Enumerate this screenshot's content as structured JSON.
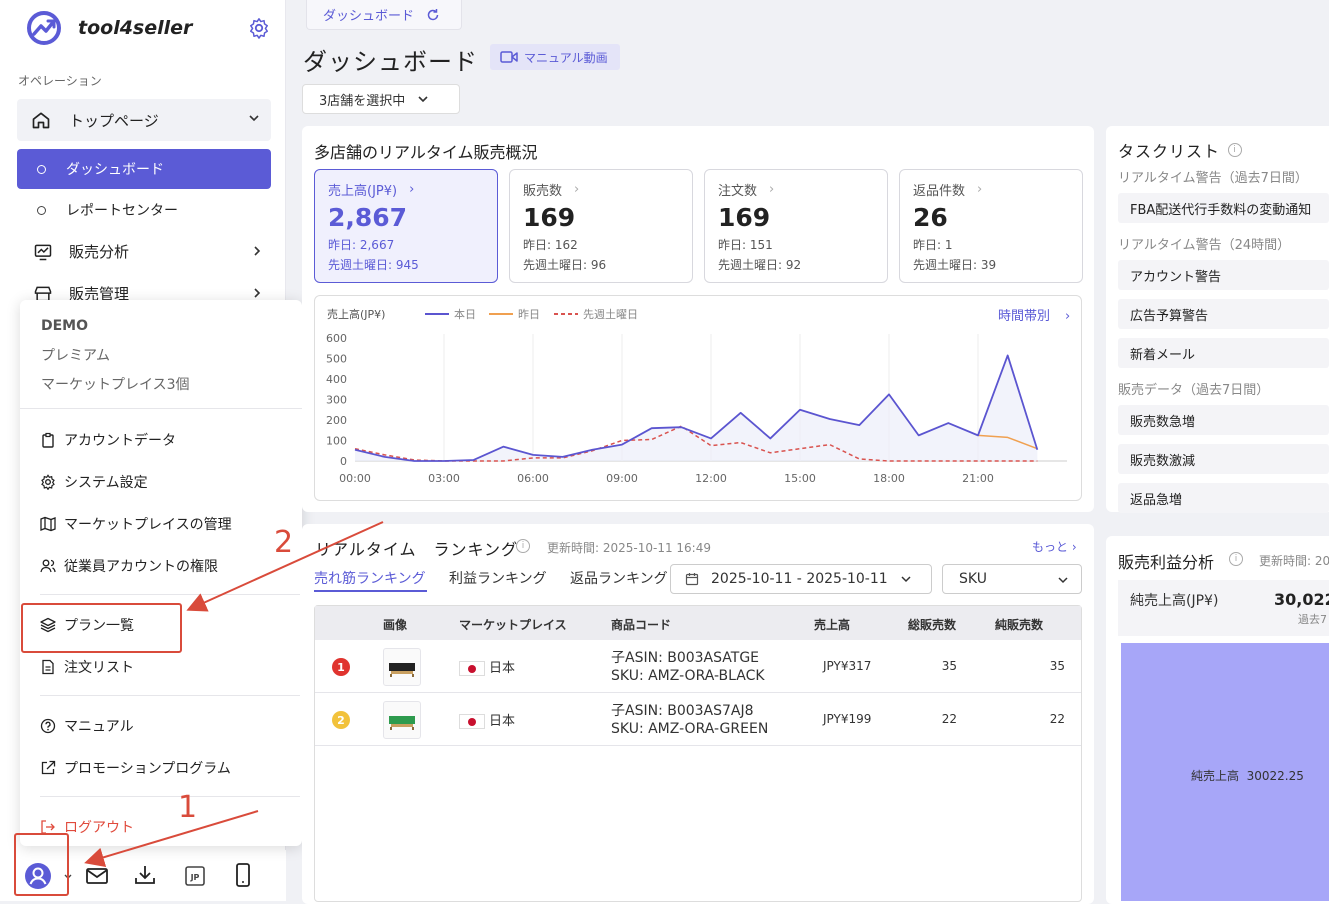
{
  "app": {
    "name": "tool4seller"
  },
  "sidebar": {
    "section_label": "オペレーション",
    "top_page": "トップページ",
    "dashboard": "ダッシュボード",
    "report_center": "レポートセンター",
    "sales_analysis": "販売分析",
    "sales_management": "販売管理"
  },
  "popup": {
    "account": "DEMO",
    "plan": "プレミアム",
    "marketplaces": "マーケットプレイス3個",
    "items": [
      "アカウントデータ",
      "システム設定",
      "マーケットプレイスの管理",
      "従業員アカウントの権限"
    ],
    "plan_list": "プラン一覧",
    "order_list": "注文リスト",
    "manual": "マニュアル",
    "promotion": "プロモーションプログラム",
    "logout": "ログアウト"
  },
  "annotations": {
    "step1": "1",
    "step2": "2"
  },
  "main": {
    "tab": "ダッシュボード",
    "title": "ダッシュボード",
    "manual_video": "マニュアル動画",
    "store_select": "3店舗を選択中"
  },
  "overview": {
    "title": "多店舗のリアルタイム販売概況",
    "kpis": [
      {
        "label": "売上高(JP¥)",
        "value": "2,867",
        "yesterday": "昨日: 2,667",
        "last_week": "先週土曜日: 945"
      },
      {
        "label": "販売数",
        "value": "169",
        "yesterday": "昨日: 162",
        "last_week": "先週土曜日: 96"
      },
      {
        "label": "注文数",
        "value": "169",
        "yesterday": "昨日: 151",
        "last_week": "先週土曜日: 92"
      },
      {
        "label": "返品件数",
        "value": "26",
        "yesterday": "昨日: 1",
        "last_week": "先週土曜日: 39"
      }
    ]
  },
  "chart_data": {
    "type": "line",
    "ylabel": "売上高(JP¥)",
    "link": "時間帯別",
    "ylim": [
      0,
      600
    ],
    "yticks": [
      "600",
      "500",
      "400",
      "300",
      "200",
      "100",
      "0"
    ],
    "xticks": [
      "00:00",
      "03:00",
      "06:00",
      "09:00",
      "12:00",
      "15:00",
      "18:00",
      "21:00"
    ],
    "x_hours": [
      0,
      1,
      2,
      3,
      4,
      5,
      6,
      7,
      8,
      9,
      10,
      11,
      12,
      13,
      14,
      15,
      16,
      17,
      18,
      19,
      20,
      21,
      22,
      23
    ],
    "series": [
      {
        "name": "本日",
        "color": "#5b55d0",
        "values": [
          55,
          20,
          0,
          0,
          5,
          70,
          30,
          20,
          55,
          80,
          160,
          165,
          110,
          235,
          110,
          250,
          205,
          175,
          325,
          125,
          185,
          125,
          515,
          55
        ]
      },
      {
        "name": "昨日",
        "color": "#f0a050",
        "values": [
          null,
          null,
          null,
          null,
          null,
          null,
          null,
          null,
          null,
          null,
          null,
          null,
          null,
          null,
          null,
          null,
          null,
          null,
          null,
          null,
          null,
          125,
          115,
          60
        ]
      },
      {
        "name": "先週土曜日",
        "color": "#d9534f",
        "values": [
          60,
          30,
          5,
          0,
          0,
          0,
          15,
          15,
          50,
          100,
          105,
          170,
          75,
          90,
          40,
          60,
          80,
          10,
          0,
          0,
          0,
          0,
          0,
          0
        ]
      }
    ]
  },
  "tasks": {
    "title": "タスクリスト",
    "sec1": "リアルタイム警告（過去7日間）",
    "sec1_items": [
      "FBA配送代行手数料の変動通知"
    ],
    "sec2": "リアルタイム警告（24時間）",
    "sec2_items": [
      "アカウント警告",
      "広告予算警告",
      "新着メール"
    ],
    "sec3": "販売データ（過去7日間）",
    "sec3_items": [
      "販売数急増",
      "販売数激減",
      "返品急増"
    ]
  },
  "ranking": {
    "title": "リアルタイム　ランキング",
    "updated": "更新時間: 2025-10-11 16:49",
    "more": "もっと",
    "tabs": [
      "売れ筋ランキング",
      "利益ランキング",
      "返品ランキング"
    ],
    "date_range": "2025-10-11 - 2025-10-11",
    "dimension": "SKU",
    "columns": [
      "画像",
      "マーケットプレイス",
      "商品コード",
      "売上高",
      "総販売数",
      "純販売数"
    ],
    "rows": [
      {
        "rank": "1",
        "market": "日本",
        "asin": "子ASIN: B003ASATGE",
        "sku": "SKU: AMZ-ORA-BLACK",
        "sales": "JPY¥317",
        "total": "35",
        "net": "35"
      },
      {
        "rank": "2",
        "market": "日本",
        "asin": "子ASIN: B003AS7AJ8",
        "sku": "SKU: AMZ-ORA-GREEN",
        "sales": "JPY¥199",
        "total": "22",
        "net": "22"
      }
    ]
  },
  "profit": {
    "title": "販売利益分析",
    "updated": "更新時間: 20",
    "net_sales_label": "純売上高(JP¥)",
    "net_sales_value": "30,022",
    "net_sales_sub": "過去7",
    "block_label": "純売上高  30022.25",
    "block_color": "#a7a6f8"
  }
}
